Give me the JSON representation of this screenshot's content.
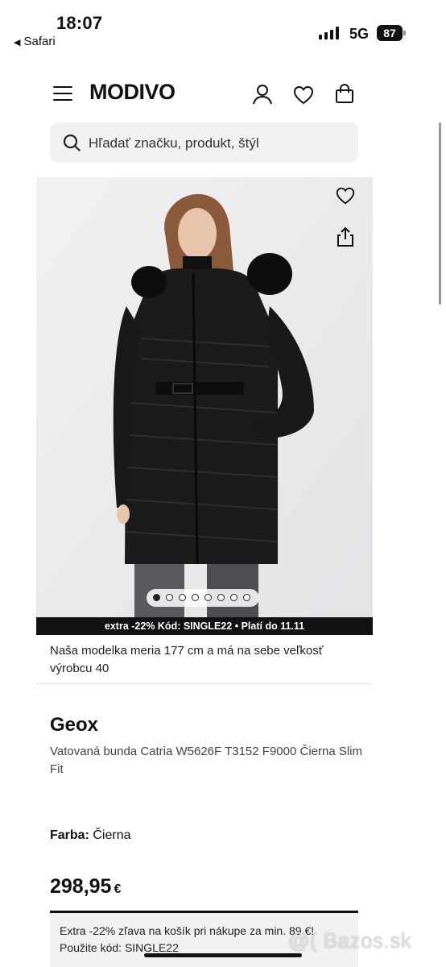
{
  "status_bar": {
    "time": "18:07",
    "back_label": "Safari",
    "network": "5G",
    "battery": "87"
  },
  "header": {
    "logo": "MODIVO"
  },
  "search": {
    "placeholder": "Hľadať značku, produkt, štýl"
  },
  "gallery": {
    "image_count": 8,
    "active_index": 0,
    "promo_banner": "extra -22% Kód: SINGLE22 • Platí do 11.11"
  },
  "product": {
    "model_note": "Naša modelka meria 177 cm a má na sebe veľkosť výrobcu 40",
    "brand": "Geox",
    "name": "Vatovaná bunda Catria W5626F T3152 F9000 Čierna Slim Fit",
    "color_label": "Farba:",
    "color_value": "Čierna",
    "price": "298,95",
    "currency": "€"
  },
  "promo_box": {
    "line1": "Extra -22% zľava na košík pri nákupe za min. 89 €!",
    "line2": "Použite kód: SINGLE22"
  },
  "watermark": "@( Bazos.sk",
  "icons": [
    "menu-icon",
    "user-icon",
    "heart-icon",
    "bag-icon",
    "search-icon",
    "favorite-icon",
    "share-icon"
  ]
}
